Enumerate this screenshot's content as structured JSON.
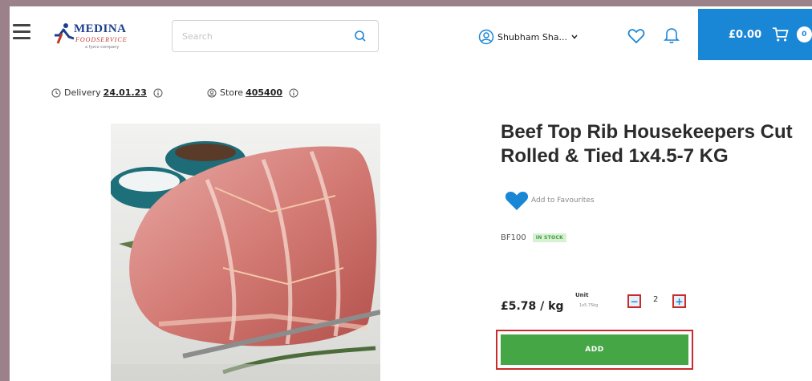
{
  "header": {
    "logo": {
      "name": "MEDINA",
      "sub": "FOODSERVICE",
      "tag": "a fyzco company"
    },
    "search": {
      "placeholder": "Search",
      "value": ""
    },
    "user": {
      "name": "Shubham Sha..."
    },
    "cart": {
      "total": "£0.00",
      "count": "0"
    }
  },
  "info": {
    "delivery_label": "Delivery",
    "delivery_date": "24.01.23",
    "store_label": "Store",
    "store_number": "405400"
  },
  "product": {
    "title_line1": "Beef Top Rib Housekeepers Cut",
    "title_line2": "Rolled & Tied 1x4.5-7 KG",
    "favourites_label": "Add to Favourites",
    "sku": "BF100",
    "stock_status": "IN STOCK",
    "price": "£5.78 / kg",
    "unit_label": "Unit",
    "unit_value": "1x5.75kg",
    "quantity": "2",
    "minus_label": "−",
    "plus_label": "+",
    "add_label": "ADD"
  },
  "colors": {
    "accent": "#1a86d6",
    "add_button": "#45a645",
    "highlight": "#c92a2a",
    "in_stock_bg": "#d8f0d3"
  }
}
